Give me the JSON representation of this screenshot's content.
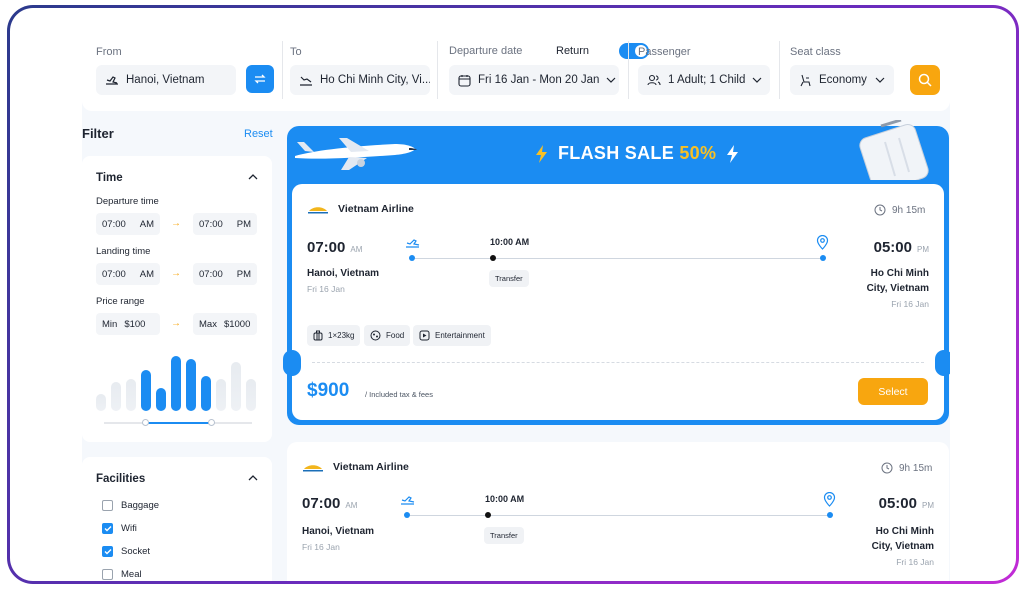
{
  "search": {
    "from_label": "From",
    "from_value": "Hanoi, Vietnam",
    "to_label": "To",
    "to_value": "Ho Chi Minh City, Vi...",
    "date_label": "Departure date",
    "return_label": "Return",
    "return_on": true,
    "date_value": "Fri 16 Jan - Mon 20 Jan",
    "passenger_label": "Passenger",
    "passenger_value": "1 Adult; 1 Child",
    "seat_label": "Seat class",
    "seat_value": "Economy"
  },
  "filter": {
    "title": "Filter",
    "reset": "Reset",
    "time": {
      "title": "Time",
      "departure_label": "Departure time",
      "dep_from_time": "07:00",
      "dep_from_period": "AM",
      "dep_to_time": "07:00",
      "dep_to_period": "PM",
      "landing_label": "Landing time",
      "land_from_time": "07:00",
      "land_from_period": "AM",
      "land_to_time": "07:00",
      "land_to_period": "PM",
      "price_label": "Price range",
      "min_label": "Min",
      "min_value": "$100",
      "max_label": "Max",
      "max_value": "$1000",
      "histogram": [
        0.3,
        0.5,
        0.55,
        0.7,
        0.4,
        0.95,
        0.9,
        0.6,
        0.55,
        0.85,
        0.55
      ],
      "histogram_selected": [
        false,
        false,
        false,
        true,
        true,
        true,
        true,
        true,
        false,
        false,
        false
      ],
      "range_fraction": [
        0.28,
        0.72
      ]
    },
    "facilities": {
      "title": "Facilities",
      "items": [
        {
          "label": "Baggage",
          "checked": false
        },
        {
          "label": "Wifi",
          "checked": true
        },
        {
          "label": "Socket",
          "checked": true
        },
        {
          "label": "Meal",
          "checked": false
        }
      ]
    }
  },
  "flash": {
    "title": "FLASH SALE",
    "percent": "50%",
    "airline": "Vietnam Airline",
    "duration": "9h 15m",
    "dep_time": "07:00",
    "dep_period": "AM",
    "dep_city": "Hanoi, Vietnam",
    "dep_date": "Fri 16 Jan",
    "transfer_time": "10:00 AM",
    "transfer_label": "Transfer",
    "arr_time": "05:00",
    "arr_period": "PM",
    "arr_city_1": "Ho Chi Minh",
    "arr_city_2": "City, Vietnam",
    "arr_date": "Fri 16 Jan",
    "amenities": [
      "1×23kg",
      "Food",
      "Entertainment"
    ],
    "price": "$900",
    "price_note": "/ Included tax & fees",
    "select": "Select"
  },
  "second": {
    "airline": "Vietnam Airline",
    "duration": "9h 15m",
    "dep_time": "07:00",
    "dep_period": "AM",
    "dep_city": "Hanoi, Vietnam",
    "dep_date": "Fri 16 Jan",
    "transfer_time": "10:00 AM",
    "transfer_label": "Transfer",
    "arr_time": "05:00",
    "arr_period": "PM",
    "arr_city_1": "Ho Chi Minh",
    "arr_city_2": "City, Vietnam",
    "arr_date": "Fri 16 Jan"
  },
  "colors": {
    "accent": "#1b8cf2",
    "orange": "#f8a60f",
    "yellow": "#f8c024"
  }
}
